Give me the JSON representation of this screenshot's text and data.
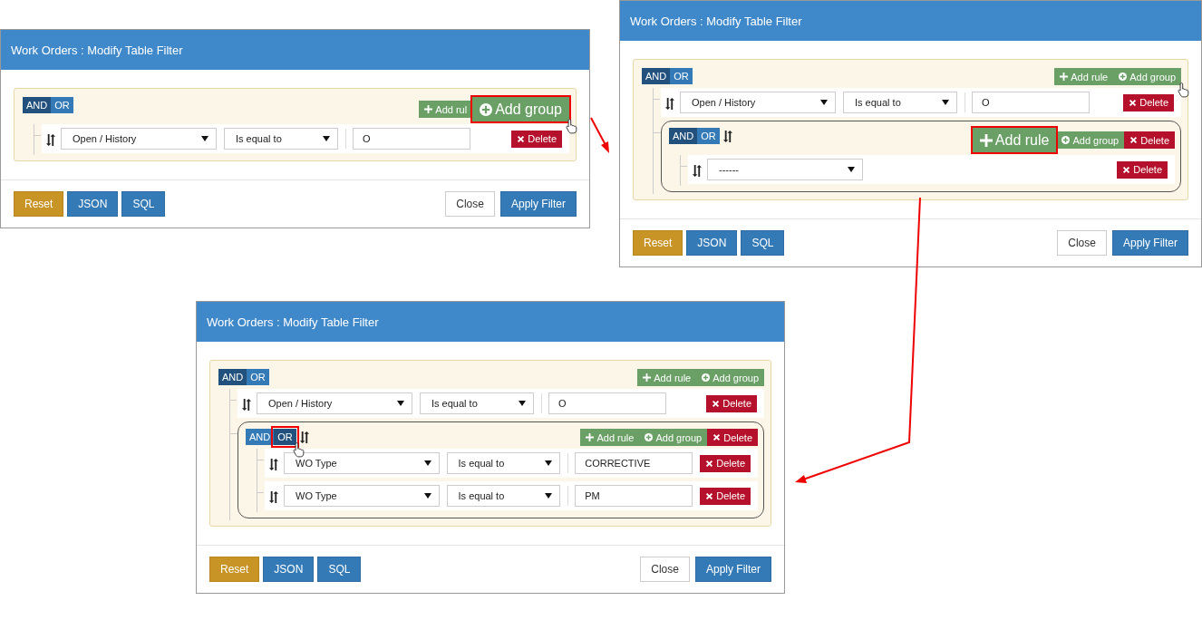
{
  "dialogs": [
    {
      "title": "Work Orders : Modify Table Filter",
      "group": {
        "conditions": [
          {
            "label": "AND",
            "selected": true,
            "highlighted": false,
            "hovered": false
          },
          {
            "label": "OR",
            "selected": false,
            "highlighted": false,
            "hovered": false
          }
        ],
        "actions": [
          {
            "kind": "add_rule",
            "label": "Add rul",
            "highlighted": false,
            "hovered": false
          },
          {
            "kind": "add_group",
            "label": "Add group",
            "highlighted": true,
            "hovered": true
          }
        ],
        "children": [
          {
            "kind": "rule",
            "field": "Open / History",
            "operator": "Is equal to",
            "value": "O",
            "delete": "Delete"
          }
        ]
      },
      "footer": {
        "left": [
          {
            "kind": "warning",
            "label": "Reset"
          },
          {
            "kind": "primary",
            "label": "JSON"
          },
          {
            "kind": "primary",
            "label": "SQL"
          }
        ],
        "right": [
          {
            "kind": "default",
            "label": "Close"
          },
          {
            "kind": "primary",
            "label": "Apply Filter"
          }
        ]
      }
    },
    {
      "title": "Work Orders : Modify Table Filter",
      "group": {
        "conditions": [
          {
            "label": "AND",
            "selected": true,
            "highlighted": false,
            "hovered": false
          },
          {
            "label": "OR",
            "selected": false,
            "highlighted": false,
            "hovered": false
          }
        ],
        "actions": [
          {
            "kind": "add_rule",
            "label": "Add rule",
            "highlighted": false,
            "hovered": false
          },
          {
            "kind": "add_group",
            "label": "Add group",
            "highlighted": false,
            "hovered": true
          }
        ],
        "children": [
          {
            "kind": "rule",
            "field": "Open / History",
            "operator": "Is equal to",
            "value": "O",
            "delete": "Delete"
          },
          {
            "kind": "group",
            "conditions": [
              {
                "label": "AND",
                "selected": true,
                "highlighted": false,
                "hovered": false
              },
              {
                "label": "OR",
                "selected": false,
                "highlighted": false,
                "hovered": false
              }
            ],
            "actions": [
              {
                "kind": "add_rule",
                "label": "Add rule",
                "highlighted": true,
                "hovered": false
              },
              {
                "kind": "add_group",
                "label": "Add group",
                "highlighted": false,
                "hovered": false
              },
              {
                "kind": "delete",
                "label": "Delete",
                "highlighted": false,
                "hovered": false
              }
            ],
            "children": [
              {
                "kind": "rule",
                "field": "------",
                "delete": "Delete"
              }
            ]
          }
        ]
      },
      "footer": {
        "left": [
          {
            "kind": "warning",
            "label": "Reset"
          },
          {
            "kind": "primary",
            "label": "JSON"
          },
          {
            "kind": "primary",
            "label": "SQL"
          }
        ],
        "right": [
          {
            "kind": "default",
            "label": "Close"
          },
          {
            "kind": "primary",
            "label": "Apply Filter"
          }
        ]
      }
    },
    {
      "title": "Work Orders : Modify Table Filter",
      "group": {
        "conditions": [
          {
            "label": "AND",
            "selected": true,
            "highlighted": false,
            "hovered": false
          },
          {
            "label": "OR",
            "selected": false,
            "highlighted": false,
            "hovered": false
          }
        ],
        "actions": [
          {
            "kind": "add_rule",
            "label": "Add rule",
            "highlighted": false,
            "hovered": false
          },
          {
            "kind": "add_group",
            "label": "Add group",
            "highlighted": false,
            "hovered": false
          }
        ],
        "children": [
          {
            "kind": "rule",
            "field": "Open / History",
            "operator": "Is equal to",
            "value": "O",
            "delete": "Delete"
          },
          {
            "kind": "group",
            "conditions": [
              {
                "label": "AND",
                "selected": false,
                "highlighted": false,
                "hovered": false
              },
              {
                "label": "OR",
                "selected": true,
                "highlighted": true,
                "hovered": true
              }
            ],
            "actions": [
              {
                "kind": "add_rule",
                "label": "Add rule",
                "highlighted": false,
                "hovered": false
              },
              {
                "kind": "add_group",
                "label": "Add group",
                "highlighted": false,
                "hovered": false
              },
              {
                "kind": "delete",
                "label": "Delete",
                "highlighted": false,
                "hovered": false
              }
            ],
            "children": [
              {
                "kind": "rule",
                "field": "WO Type",
                "operator": "Is equal to",
                "value": "CORRECTIVE",
                "delete": "Delete"
              },
              {
                "kind": "rule",
                "field": "WO Type",
                "operator": "Is equal to",
                "value": "PM",
                "delete": "Delete"
              }
            ]
          }
        ]
      },
      "footer": {
        "left": [
          {
            "kind": "warning",
            "label": "Reset"
          },
          {
            "kind": "primary",
            "label": "JSON"
          },
          {
            "kind": "primary",
            "label": "SQL"
          }
        ],
        "right": [
          {
            "kind": "default",
            "label": "Close"
          },
          {
            "kind": "primary",
            "label": "Apply Filter"
          }
        ]
      }
    }
  ]
}
